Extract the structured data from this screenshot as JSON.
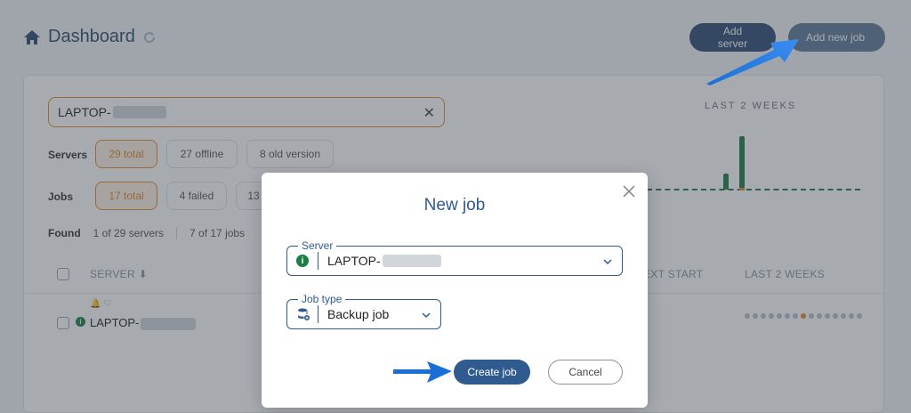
{
  "header": {
    "title": "Dashboard"
  },
  "top_buttons": {
    "add_server": "Add server",
    "add_new_job": "Add new job"
  },
  "search": {
    "value": "LAPTOP-"
  },
  "servers_row": {
    "label": "Servers",
    "total": "29 total",
    "offline": "27 offline",
    "old_version": "8 old version"
  },
  "jobs_row": {
    "label": "Jobs",
    "total": "17 total",
    "failed": "4 failed",
    "partial": "13"
  },
  "found": {
    "label": "Found",
    "servers": "1 of 29 servers",
    "jobs": "7 of 17 jobs"
  },
  "table": {
    "col_server": "SERVER",
    "col_next_start": "EXT START",
    "col_last_2_weeks": "LAST 2 WEEKS",
    "row_server": "LAPTOP-"
  },
  "chart": {
    "title": "LAST 2 WEEKS"
  },
  "modal": {
    "title": "New job",
    "server_legend": "Server",
    "server_value": "LAPTOP-",
    "job_type_legend": "Job type",
    "job_type_value": "Backup job",
    "create_button": "Create job",
    "cancel_button": "Cancel"
  },
  "colors": {
    "accent": "#2f5b8f",
    "orange": "#e08a2c",
    "green": "#1e7d45"
  }
}
